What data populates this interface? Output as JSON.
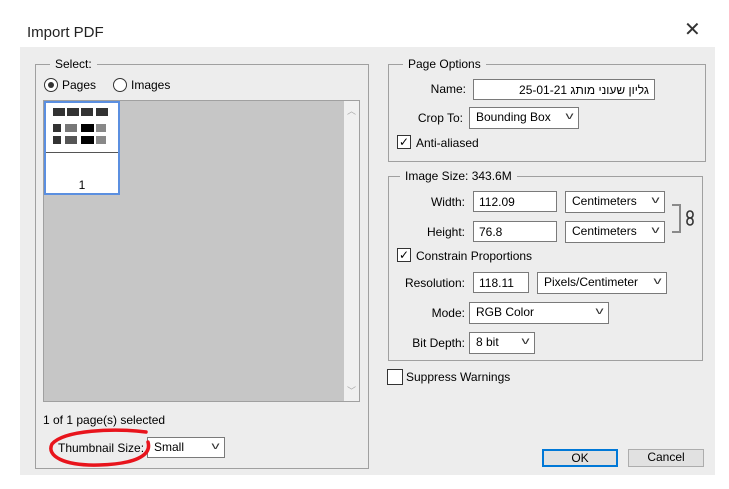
{
  "window": {
    "title": "Import PDF"
  },
  "select_group": {
    "legend": "Select:",
    "radio_pages": "Pages",
    "radio_images": "Images",
    "selected_radio": "Pages",
    "thumbnails": [
      {
        "page_number": "1"
      }
    ],
    "status": "1 of 1 page(s) selected",
    "thumbnail_size_label": "Thumbnail Size:",
    "thumbnail_size_value": "Small"
  },
  "page_options": {
    "legend": "Page Options",
    "name_label": "Name:",
    "name_value": "גליון שעוני מותג 25-01-21",
    "crop_label": "Crop To:",
    "crop_value": "Bounding Box",
    "anti_aliased_label": "Anti-aliased",
    "anti_aliased_checked": true
  },
  "image_size": {
    "legend": "Image Size: 343.6M",
    "width_label": "Width:",
    "width_value": "112.09",
    "width_unit": "Centimeters",
    "height_label": "Height:",
    "height_value": "76.8",
    "height_unit": "Centimeters",
    "constrain_label": "Constrain Proportions",
    "constrain_checked": true,
    "resolution_label": "Resolution:",
    "resolution_value": "118.11",
    "resolution_unit": "Pixels/Centimeter",
    "mode_label": "Mode:",
    "mode_value": "RGB Color",
    "bit_depth_label": "Bit Depth:",
    "bit_depth_value": "8 bit"
  },
  "suppress_warnings_label": "Suppress Warnings",
  "buttons": {
    "ok": "OK",
    "cancel": "Cancel"
  },
  "colors": {
    "accent": "#0078d7",
    "annotation": "#e8141c",
    "list_bg": "#c6c6c6"
  }
}
